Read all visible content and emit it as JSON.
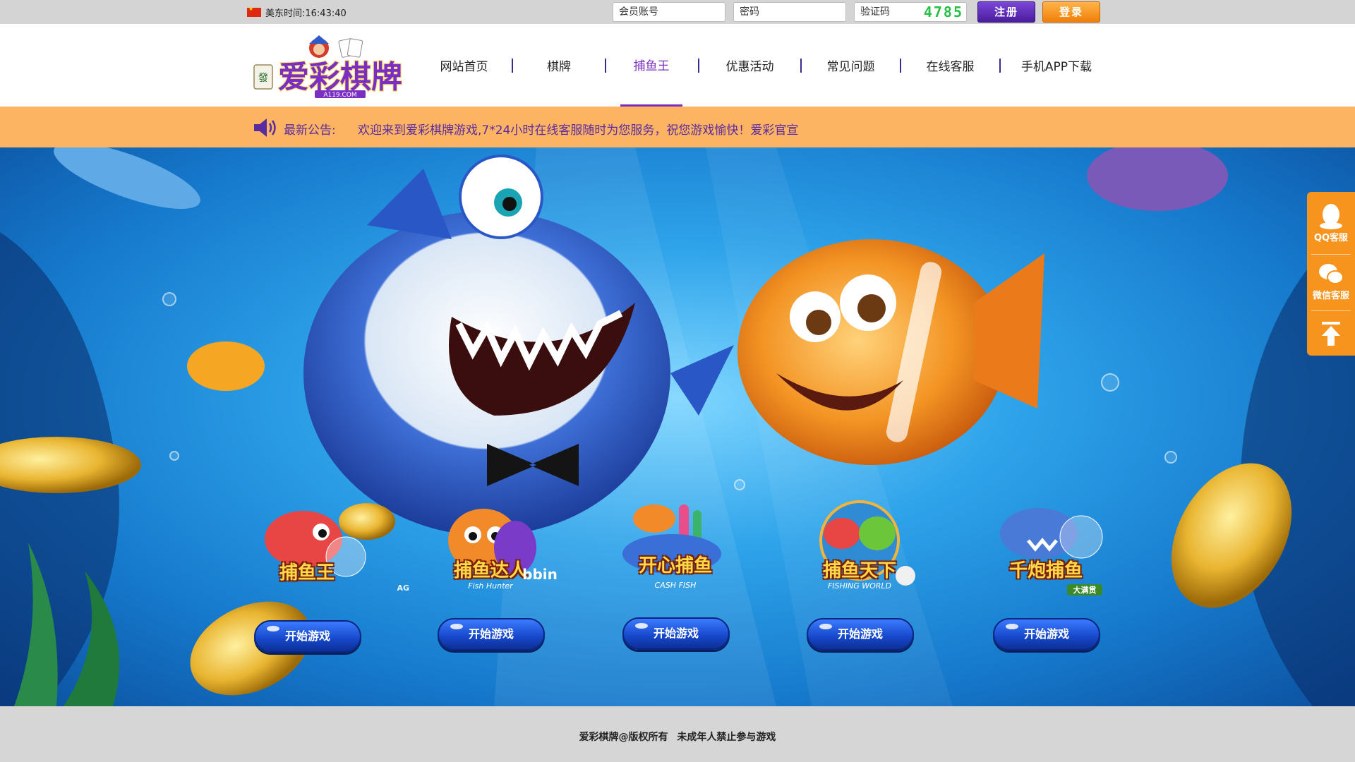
{
  "topbar": {
    "clock_label": "美东时间:16:43:40",
    "username_placeholder": "会员账号",
    "password_placeholder": "密码",
    "captcha_placeholder": "验证码",
    "captcha_code": "4785",
    "register_label": "注册",
    "login_label": "登录"
  },
  "header": {
    "logo_text": "爱彩棋牌",
    "logo_domain": "A119.COM",
    "nav": [
      {
        "label": "网站首页"
      },
      {
        "label": "棋牌"
      },
      {
        "label": "捕鱼王",
        "active": true
      },
      {
        "label": "优惠活动"
      },
      {
        "label": "常见问题"
      },
      {
        "label": "在线客服"
      },
      {
        "label": "手机APP下载"
      }
    ]
  },
  "notice": {
    "label": "最新公告:",
    "text": "欢迎来到爱彩棋牌游戏,7*24小时在线客服随时为您服务，祝您游戏愉快！爱彩官宣"
  },
  "games": [
    {
      "title": "捕鱼王",
      "badge": "AG",
      "button": "开始游戏"
    },
    {
      "title": "捕鱼达人",
      "badge": "bbin",
      "subtitle": "Fish Hunter",
      "button": "开始游戏"
    },
    {
      "title": "开心捕鱼",
      "subtitle": "CASH FISH",
      "button": "开始游戏"
    },
    {
      "title": "捕鱼天下",
      "subtitle": "FISHING WORLD",
      "button": "开始游戏"
    },
    {
      "title": "千炮捕鱼",
      "badge": "大满贯",
      "button": "开始游戏"
    }
  ],
  "side_panel": {
    "qq_label": "QQ客服",
    "wechat_label": "微信客服"
  },
  "footer": {
    "copyright": "爱彩棋牌@版权所有  未成年人禁止参与游戏"
  },
  "colors": {
    "accent_purple": "#7b2fbf",
    "notice_orange": "#fdb462",
    "side_orange": "#f7941d",
    "play_button_blue": "#1647c9",
    "captcha_green": "#27c046"
  }
}
